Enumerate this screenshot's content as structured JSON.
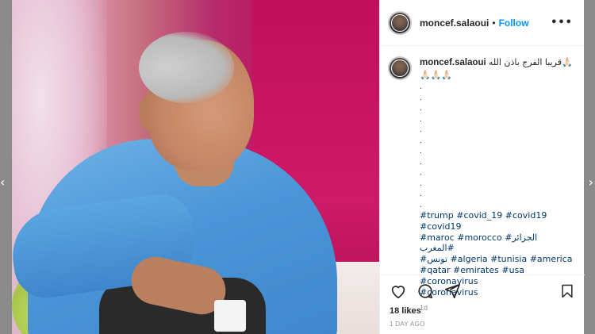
{
  "post": {
    "username": "moncef.salaoui",
    "follow_label": "Follow",
    "separator": "•",
    "more_label": "•••",
    "caption_user": "moncef.salaoui",
    "caption_text": "قريبا الفرج باذن الله🙏🏻🙏🏻🙏🏻🙏🏻",
    "dot_lines": [
      ".",
      ".",
      ".",
      ".",
      ".",
      ".",
      ".",
      ".",
      ".",
      ".",
      ".",
      "."
    ],
    "hashtags": [
      "#trump",
      "#covid_19",
      "#covid19",
      "#covid19",
      "#maroc",
      "#morocco",
      "#الجزائر",
      "#المغرب",
      "#تونس",
      "#algeria",
      "#tunisia",
      "#america",
      "#qatar",
      "#emirates",
      "#usa",
      "#coronavirus",
      "#coronavirus"
    ],
    "age": "1d",
    "likes": "18 likes",
    "date": "1 DAY AGO"
  },
  "icons": {
    "more": "more-icon",
    "like": "heart-icon",
    "comment": "comment-icon",
    "share": "share-icon",
    "save": "bookmark-icon",
    "prev": "chevron-left-icon",
    "next": "chevron-right-icon"
  },
  "colors": {
    "link": "#0095f6",
    "hashtag": "#00376b",
    "text": "#262626",
    "muted": "#8e8e8e"
  }
}
